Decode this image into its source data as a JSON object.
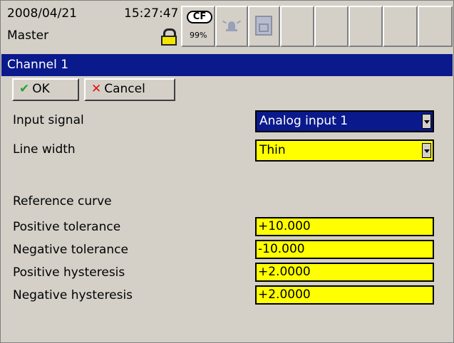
{
  "status": {
    "date": "2008/04/21",
    "time": "15:27:47",
    "user": "Master",
    "cf_label": "CF",
    "cf_usage": "99%"
  },
  "title": "Channel 1",
  "buttons": {
    "ok": "OK",
    "cancel": "Cancel"
  },
  "form": {
    "input_signal": {
      "label": "Input signal",
      "value": "Analog input 1"
    },
    "line_width": {
      "label": "Line width",
      "value": "Thin"
    },
    "reference_curve": "Reference curve",
    "positive_tolerance": {
      "label": "Positive tolerance",
      "value": "+10.000"
    },
    "negative_tolerance": {
      "label": "Negative tolerance",
      "value": "-10.000"
    },
    "positive_hysteresis": {
      "label": "Positive hysteresis",
      "value": "+2.0000"
    },
    "negative_hysteresis": {
      "label": "Negative hysteresis",
      "value": "+2.0000"
    }
  },
  "icons": [
    "lock-icon",
    "cf-card-icon",
    "alarm-icon",
    "memory-icon"
  ],
  "colors": {
    "title_bar": "#0a1a8c",
    "field_highlight": "#ffff00",
    "background": "#d4d0c8"
  }
}
